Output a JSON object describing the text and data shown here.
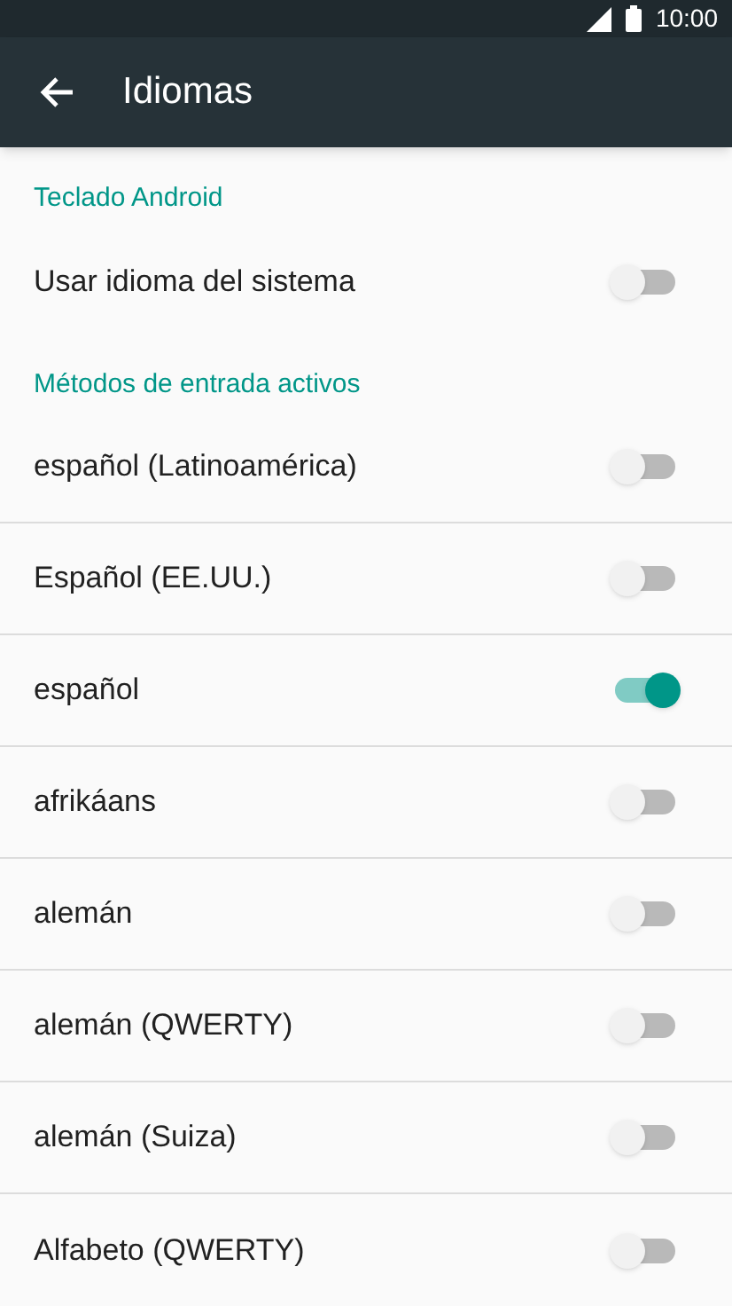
{
  "status_bar": {
    "time": "10:00"
  },
  "app_bar": {
    "title": "Idiomas"
  },
  "sections": [
    {
      "header": "Teclado Android",
      "items": [
        {
          "label": "Usar idioma del sistema",
          "on": false
        }
      ]
    },
    {
      "header": "Métodos de entrada activos",
      "items": [
        {
          "label": "español (Latinoamérica)",
          "on": false
        },
        {
          "label": "Español (EE.UU.)",
          "on": false
        },
        {
          "label": "español",
          "on": true
        },
        {
          "label": "afrikáans",
          "on": false
        },
        {
          "label": "alemán",
          "on": false
        },
        {
          "label": "alemán (QWERTY)",
          "on": false
        },
        {
          "label": "alemán (Suiza)",
          "on": false
        },
        {
          "label": "Alfabeto (QWERTY)",
          "on": false
        }
      ]
    }
  ]
}
